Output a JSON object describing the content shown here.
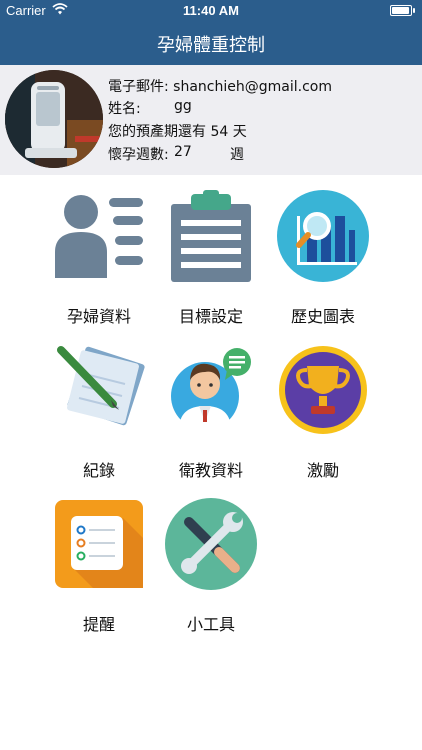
{
  "status_bar": {
    "carrier": "Carrier",
    "time": "11:40 AM",
    "battery_level": 0.95
  },
  "nav": {
    "title": "孕婦體重控制"
  },
  "profile": {
    "email_label": "電子郵件:",
    "email": "shanchieh@gmail.com",
    "name_label": "姓名:",
    "name": "gg",
    "due_prefix": "您的預產期還有",
    "due_days": "54",
    "due_unit": "天",
    "week_label": "懷孕週數:",
    "week_value": "27",
    "week_unit": "週"
  },
  "menu": {
    "items": [
      {
        "label": "孕婦資料",
        "icon": "person-list-icon"
      },
      {
        "label": "目標設定",
        "icon": "clipboard-icon"
      },
      {
        "label": "歷史圖表",
        "icon": "chart-magnifier-icon"
      },
      {
        "label": "紀錄",
        "icon": "notepad-pencil-icon"
      },
      {
        "label": "衛教資料",
        "icon": "doctor-chat-icon"
      },
      {
        "label": "激勵",
        "icon": "trophy-icon"
      },
      {
        "label": "提醒",
        "icon": "reminder-list-icon"
      },
      {
        "label": "小工具",
        "icon": "tools-icon"
      }
    ]
  },
  "colors": {
    "nav_bg": "#2b5d8c",
    "profile_bg": "#eeeef2",
    "icon_slate": "#6b8196",
    "icon_teal": "#39b4d6",
    "icon_green": "#45a78a",
    "icon_gold": "#f7c21b",
    "icon_purple": "#5b3ea6",
    "icon_orange": "#f39b1b"
  }
}
